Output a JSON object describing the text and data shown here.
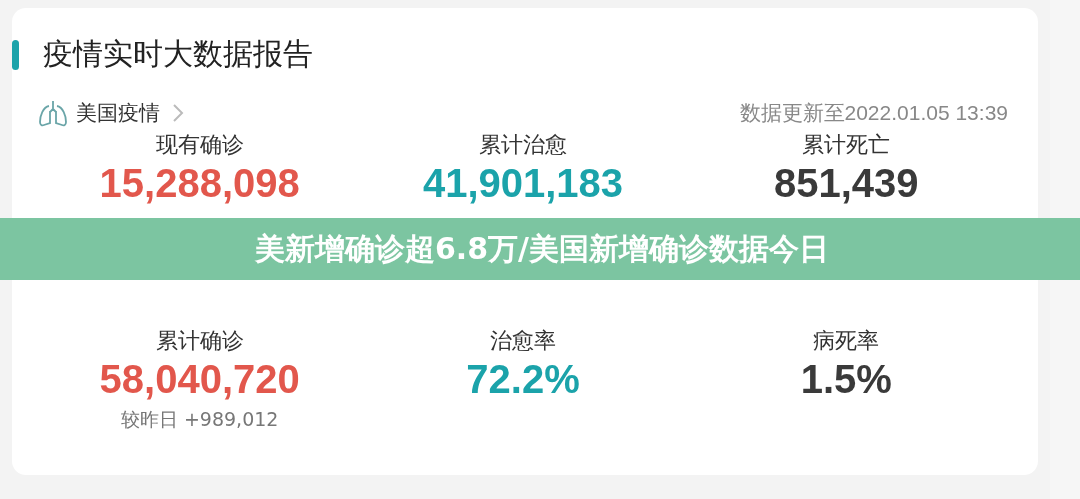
{
  "header": {
    "title": "疫情实时大数据报告"
  },
  "region": {
    "label": "美国疫情",
    "updated": "数据更新至2022.01.05 13:39"
  },
  "stat_rows": [
    [
      {
        "label": "现有确诊",
        "value": "15,288,098",
        "color": "#e2574c"
      },
      {
        "label": "累计治愈",
        "value": "41,901,183",
        "color": "#1ba3aa"
      },
      {
        "label": "累计死亡",
        "value": "851,439",
        "color": "#3a3a3a"
      }
    ],
    [
      {
        "label": "累计确诊",
        "value": "58,040,720",
        "color": "#e2574c",
        "delta": "较昨日 +989,012"
      },
      {
        "label": "治愈率",
        "value": "72.2%",
        "color": "#1ba3aa"
      },
      {
        "label": "病死率",
        "value": "1.5%",
        "color": "#3a3a3a"
      }
    ]
  ],
  "banner": {
    "text": "美新增确诊超6.8万/美国新增确诊数据今日"
  }
}
